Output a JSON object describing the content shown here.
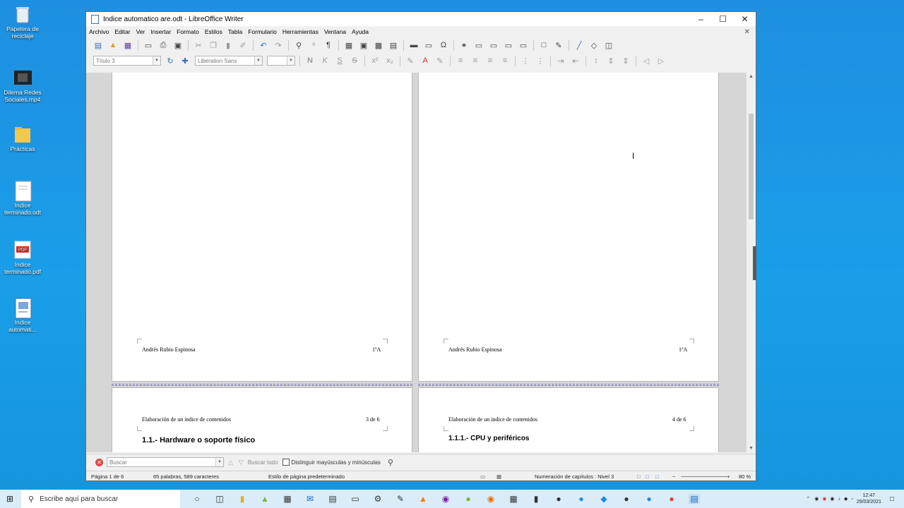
{
  "desktop": {
    "icons": [
      {
        "label": "Papelera de reciclaje",
        "icon": "recycle-bin-icon"
      },
      {
        "label": "Dilema Redes Sociales.mp4",
        "icon": "video-file-icon"
      },
      {
        "label": "Prácticas",
        "icon": "folder-icon"
      },
      {
        "label": "Indice terminado.odt",
        "icon": "document-icon"
      },
      {
        "label": "Indice terminado.pdf",
        "icon": "pdf-icon"
      },
      {
        "label": "Indice automati...",
        "icon": "writer-document-icon"
      }
    ]
  },
  "window": {
    "title": "Indice automatico are.odt - LibreOffice Writer",
    "menu": [
      "Archivo",
      "Editar",
      "Ver",
      "Insertar",
      "Formato",
      "Estilos",
      "Tabla",
      "Formulario",
      "Herramientas",
      "Ventana",
      "Ayuda"
    ],
    "paragraph_style": "Título 3",
    "font_name": "Liberation Sans",
    "font_size": ""
  },
  "pages": {
    "p1_footer_left": "Andrés Rubio Espinosa",
    "p1_footer_right": "1ºA",
    "p2_footer_left": "Andrés Rubio Espinosa",
    "p2_footer_right": "1ºA",
    "p3_header_left": "Elaboración de un índice de contenidos",
    "p3_header_right": "3 de 6",
    "p3_heading": "1.1.- Hardware o soporte físico",
    "p4_header_left": "Elaboración de un índice de contenidos",
    "p4_header_right": "4 de 6",
    "p4_heading": "1.1.1.- CPU y periféricos"
  },
  "findbar": {
    "placeholder": "Buscar",
    "find_all": "Buscar todo",
    "match_case": "Distinguir mayúsculas y minúsculas"
  },
  "status": {
    "page": "Página 1 de 6",
    "words": "65 palabras, 589 caracteres",
    "page_style": "Estilo de página predeterminado",
    "outline": "Numeración de capítulos : Nivel 3",
    "zoom": "80 %"
  },
  "taskbar": {
    "search_placeholder": "Escribe aquí para buscar",
    "time": "12:47",
    "date": "29/03/2021"
  }
}
